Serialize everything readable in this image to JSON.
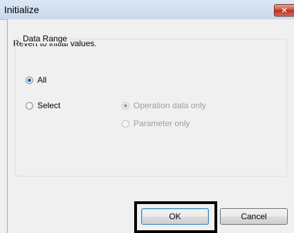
{
  "window": {
    "title": "Initialize",
    "close_glyph": "✕"
  },
  "description": "Revert to initial values.",
  "data_range": {
    "label": "Data Range",
    "options": [
      {
        "label": "All",
        "checked": true,
        "enabled": true
      },
      {
        "label": "Select",
        "checked": false,
        "enabled": true
      }
    ],
    "sub_options": [
      {
        "label": "Operation data only",
        "checked": true,
        "enabled": false
      },
      {
        "label": "Parameter only",
        "checked": false,
        "enabled": false
      }
    ]
  },
  "buttons": {
    "ok": "OK",
    "cancel": "Cancel"
  },
  "colors": {
    "close_button": "#c9493a",
    "highlight_box": "#000000"
  }
}
